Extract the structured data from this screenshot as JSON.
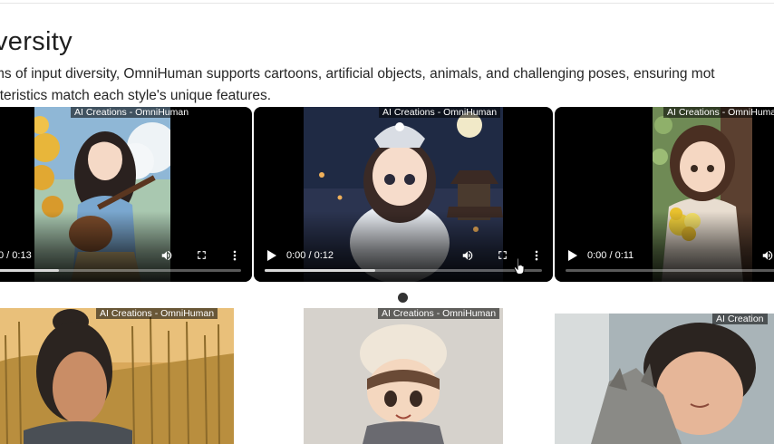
{
  "section": {
    "title": "versity",
    "description_lines": [
      "ms of input diversity, OmniHuman supports cartoons, artificial objects, animals, and challenging poses, ensuring mot",
      "cteristics match each style's unique features."
    ]
  },
  "watermark": "AI Creations - OmniHuman",
  "watermark_partial": "AI Creation",
  "videos": [
    {
      "time": "0 / 0:13",
      "progress": 0.25
    },
    {
      "time": "0:00 / 0:12",
      "progress": 0.4
    },
    {
      "time": "0:00 / 0:11",
      "progress": 0.0
    }
  ],
  "icons": {
    "play": "play-icon",
    "volume": "volume-icon",
    "fullscreen": "fullscreen-icon",
    "more": "more-vert-icon",
    "cursor": "hand-pointer-icon",
    "carousel": "carousel-dot"
  },
  "colors": {
    "text": "#1f1f1f",
    "control_track": "#d8d8d8",
    "video_bg": "#000000"
  }
}
